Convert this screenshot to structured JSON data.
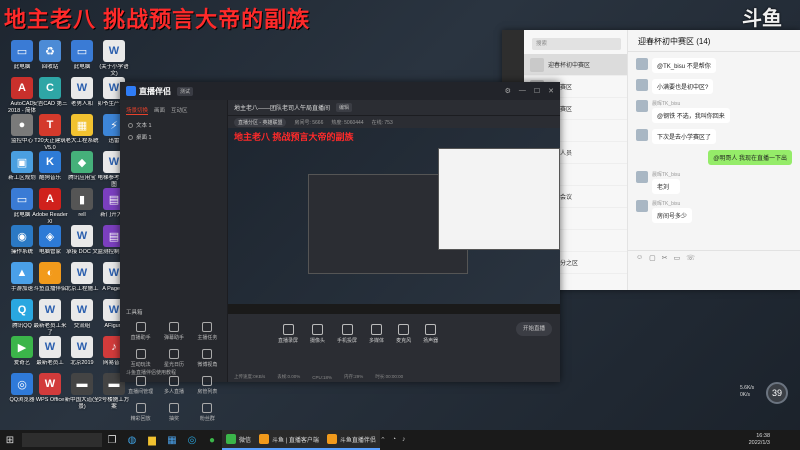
{
  "overlay_title": "地主老八 挑战预言大帝的副族",
  "douyu_logo": "斗鱼",
  "desktop": {
    "icons": [
      {
        "label": "此电脑",
        "color": "#3a7bd5",
        "glyph": "▭"
      },
      {
        "label": "回收站",
        "color": "#4c8bd6",
        "glyph": "♻"
      },
      {
        "label": "此电脑",
        "color": "#3a7bd5",
        "glyph": "▭"
      },
      {
        "label": "(关于小学语文)",
        "color": "#e9e9e9",
        "glyph": "W"
      },
      {
        "label": "AutoCAD 2018 - 简体",
        "color": "#c9302c",
        "glyph": "A"
      },
      {
        "label": "安吉CAD 第三",
        "color": "#2ea6a6",
        "glyph": "C"
      },
      {
        "label": "老男人和",
        "color": "#e9e9e9",
        "glyph": "W"
      },
      {
        "label": "卯爷生产方案",
        "color": "#e9e9e9",
        "glyph": "W"
      },
      {
        "label": "监控中心",
        "color": "#7a7a7a",
        "glyph": "●"
      },
      {
        "label": "T20天正建筑V5.0",
        "color": "#d43a2c",
        "glyph": "T"
      },
      {
        "label": "老大工程系统",
        "color": "#f2c230",
        "glyph": "▦"
      },
      {
        "label": "迅雷",
        "color": "#3d86d8",
        "glyph": "⚡"
      },
      {
        "label": "新工区规划",
        "color": "#4a9fe0",
        "glyph": "▣"
      },
      {
        "label": "酷狗音乐",
        "color": "#2e7bd6",
        "glyph": "K"
      },
      {
        "label": "腾讯应用宝",
        "color": "#45b07a",
        "glyph": "◆"
      },
      {
        "label": "电梯参考示意图",
        "color": "#e9e9e9",
        "glyph": "W"
      },
      {
        "label": "此电脑",
        "color": "#3a7bd5",
        "glyph": "▭"
      },
      {
        "label": "Adobe Reader XI",
        "color": "#d0211c",
        "glyph": "A"
      },
      {
        "label": "rell",
        "color": "#555",
        "glyph": "▮"
      },
      {
        "label": "新门开大专",
        "color": "#7b3fbf",
        "glyph": "▤"
      },
      {
        "label": "操作系统",
        "color": "#2b79c4",
        "glyph": "◉"
      },
      {
        "label": "电脑管家",
        "color": "#2d7ad6",
        "glyph": "◈"
      },
      {
        "label": "承接 DOC 文",
        "color": "#e9e9e9",
        "glyph": "W"
      },
      {
        "label": "监测控制系统",
        "color": "#7b3fbf",
        "glyph": "▤"
      },
      {
        "label": "手游加速",
        "color": "#4aa0e8",
        "glyph": "▲"
      },
      {
        "label": "斗鱼直播伴侣",
        "color": "#f29a1b",
        "glyph": "◐"
      },
      {
        "label": "北京工程施工",
        "color": "#e9e9e9",
        "glyph": "W"
      },
      {
        "label": "A Pagec1",
        "color": "#e9e9e9",
        "glyph": "W"
      },
      {
        "label": "腾讯QQ",
        "color": "#2aa7e0",
        "glyph": "Q"
      },
      {
        "label": "最新老员工来了",
        "color": "#e9e9e9",
        "glyph": "W"
      },
      {
        "label": "交流组",
        "color": "#e9e9e9",
        "glyph": "W"
      },
      {
        "label": "AFigure",
        "color": "#e9e9e9",
        "glyph": "W"
      },
      {
        "label": "爱奇艺",
        "color": "#3bb54a",
        "glyph": "▶"
      },
      {
        "label": "最新老员工",
        "color": "#e9e9e9",
        "glyph": "W"
      },
      {
        "label": "北京2019",
        "color": "#e9e9e9",
        "glyph": "W"
      },
      {
        "label": "网易音乐",
        "color": "#d23b3b",
        "glyph": "♪"
      },
      {
        "label": "QQ浏览器",
        "color": "#2f7ad9",
        "glyph": "◎"
      },
      {
        "label": "WPS Office",
        "color": "#d23b3b",
        "glyph": "W"
      },
      {
        "label": "新中国大道(全景)",
        "color": "#444",
        "glyph": "▬"
      },
      {
        "label": "2号楼施工方案",
        "color": "#444",
        "glyph": "▬"
      }
    ]
  },
  "chat_window": {
    "search_placeholder": "搜索",
    "list_items": [
      "迎春杯初中赛区",
      "初中赛区",
      "小学赛区",
      "机关",
      "斗鱼人员",
      "人场",
      "学校会议",
      "卡区",
      "群",
      "华与分之区"
    ],
    "title": "迎春杯初中赛区 (14)",
    "messages": [
      {
        "name": "",
        "text": "@TK_bisu 不是帮你",
        "mine": false
      },
      {
        "name": "",
        "text": "小满要也是初中区?",
        "mine": false
      },
      {
        "name": "晨晖TK_bisu",
        "text": "@钢铁 不选，我叫你回来",
        "mine": false
      },
      {
        "name": "",
        "text": "下次是去小学赛区了",
        "mine": false
      },
      {
        "name": "",
        "text": "@明哥人 我现在直播一下出",
        "mine": true
      },
      {
        "name": "晨晖TK_bisu",
        "text": "老刘",
        "mine": false
      },
      {
        "name": "晨晖TK_bisu",
        "text": "房间号多少",
        "mine": false
      }
    ],
    "toolbar_icons": [
      "☺",
      "▢",
      "✂",
      "▭",
      "☏"
    ]
  },
  "stream_app": {
    "app_name": "直播伴侣",
    "beta": "测试",
    "tabs": [
      "场景切换",
      "画面",
      "互动区"
    ],
    "scenes": [
      "文本 1",
      "桌面 1"
    ],
    "tools_title": "工具箱",
    "tools": [
      "直播助手",
      "弹幕助手",
      "主播任务",
      "互动玩法",
      "星光日历",
      "微博视角",
      "直播间管理",
      "多人直播",
      "房管列表",
      "精彩回放",
      "抽奖",
      "粉丝群"
    ],
    "footer_left": "斗鱼直播伴侣使用教程",
    "room_title": "地主老八——团队老司人午局直播间",
    "room_tag": "编辑",
    "stats": [
      "直播分区 - 英雄联盟",
      "房间号: 5666",
      "热度: 5060444",
      "在线: 753"
    ],
    "preview_title": "地主老八 挑战预言大帝的副族",
    "controls": [
      "直播录屏",
      "摄像头",
      "手机投屏",
      "多媒体",
      "麦克风",
      "扬声器"
    ],
    "start_button": "开始直播",
    "status": [
      "上传速度:0KB/s",
      "丢帧:0.00%",
      "CPU:18%",
      "内存:29%",
      "时长:00:00:00"
    ]
  },
  "net_widget": {
    "up": "5.6K/s",
    "down": "0K/s",
    "value": "39"
  },
  "taskbar": {
    "apps": [
      {
        "label": "微信",
        "color": "#3bb54a",
        "open": true
      },
      {
        "label": "斗鱼 | 直播客户端",
        "color": "#f29a1b",
        "open": true
      },
      {
        "label": "斗鱼直播伴侣",
        "color": "#f29a1b",
        "open": true
      }
    ],
    "time": "16:38",
    "date": "2022/1/3"
  }
}
